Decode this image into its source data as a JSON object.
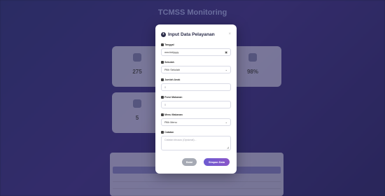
{
  "background": {
    "title": "TCMSS Monitoring",
    "cards": [
      {
        "value": "275",
        "label": ""
      },
      {
        "value": "",
        "label": ""
      },
      {
        "value": "98%",
        "label": ""
      },
      {
        "value": "5",
        "label": ""
      }
    ]
  },
  "modal": {
    "title": "Input Data Pelayanan",
    "fields": {
      "tanggal": {
        "label": "Tanggal",
        "value": "mm/dd/yyyy"
      },
      "sekolah": {
        "label": "Sekolah",
        "value": "Pilih Sekolah"
      },
      "jumlah_anak": {
        "label": "Jumlah Anak",
        "value": "0"
      },
      "porsi_makanan": {
        "label": "Porsi Makanan",
        "value": "0"
      },
      "menu_makanan": {
        "label": "Menu Makanan",
        "value": "Pilih Menu"
      },
      "catatan": {
        "label": "Catatan",
        "placeholder": "Catatan khusus (Opsional)..."
      }
    },
    "cancel_label": "Batal",
    "save_label": "Simpan Data"
  }
}
